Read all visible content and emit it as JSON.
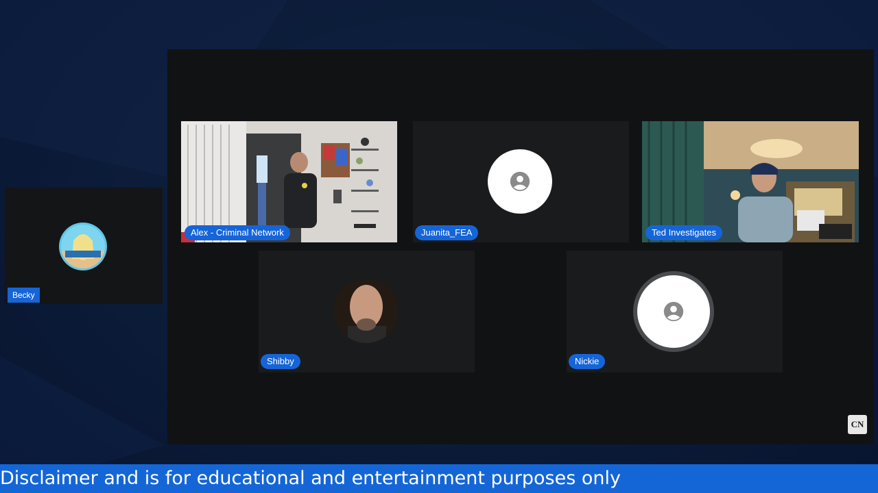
{
  "participants": {
    "alex": {
      "name": "Alex - Criminal Network"
    },
    "juanita": {
      "name": "Juanita_FEA"
    },
    "ted": {
      "name": "Ted Investigates"
    },
    "shibby": {
      "name": "Shibby"
    },
    "nickie": {
      "name": "Nickie"
    }
  },
  "sidebar": {
    "becky": {
      "name": "Becky"
    }
  },
  "branding": {
    "logo_text": "CN",
    "accent": "#1565d8"
  },
  "ticker": {
    "text": "Disclaimer and is for educational and entertainment purposes only"
  }
}
